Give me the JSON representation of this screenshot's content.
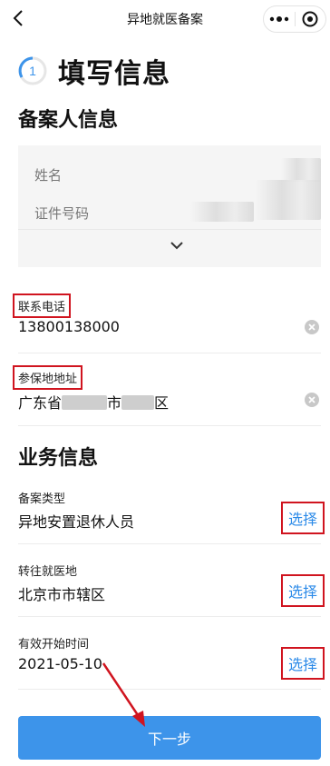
{
  "nav": {
    "title": "异地就医备案"
  },
  "step": {
    "number": "1",
    "title": "填写信息"
  },
  "person_section": {
    "title": "备案人信息",
    "name_label": "姓名",
    "id_label": "证件号码"
  },
  "contact": {
    "phone_label": "联系电话",
    "phone_value": "13800138000",
    "address_label": "参保地地址",
    "address_province": "广东省",
    "address_city_suffix": "市",
    "address_district_suffix": "区"
  },
  "business_section": {
    "title": "业务信息",
    "fields": [
      {
        "label": "备案类型",
        "value": "异地安置退休人员",
        "action": "选择"
      },
      {
        "label": "转往就医地",
        "value": "北京市市辖区",
        "action": "选择"
      },
      {
        "label": "有效开始时间",
        "value": "2021-05-10",
        "action": "选择"
      }
    ]
  },
  "footer": {
    "next_label": "下一步"
  },
  "colors": {
    "accent": "#3d94ea",
    "highlight_box": "#d0141f",
    "link": "#2b8ae8"
  }
}
